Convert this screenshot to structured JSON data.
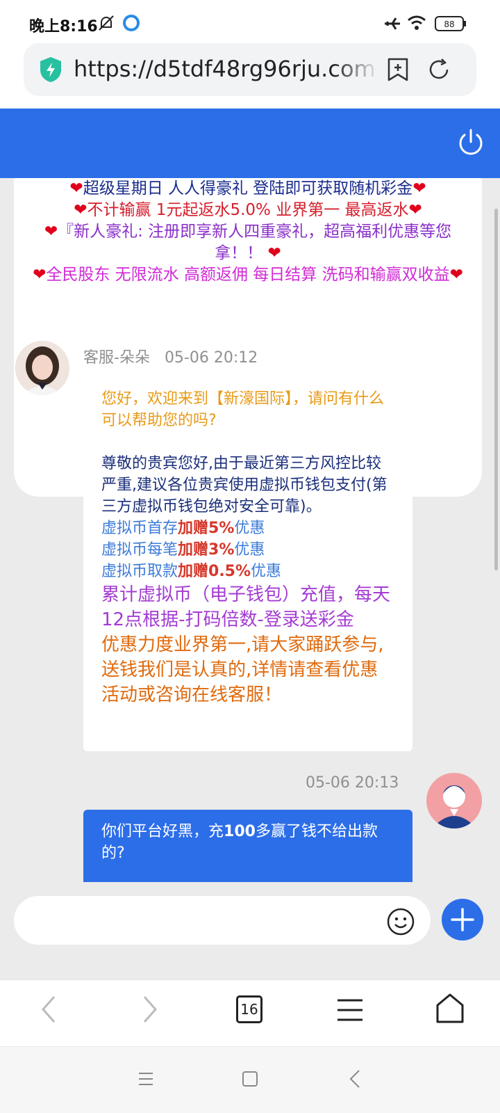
{
  "status_bar": {
    "time": "晚上8:16",
    "battery": "88"
  },
  "browser": {
    "url": "https://d5tdf48rg96rju.com",
    "tab_count": "16"
  },
  "promo": {
    "lines": [
      {
        "text": "超级星期日 人人得豪礼 登陆即可获取随机彩金",
        "color": "#1a2c8c"
      },
      {
        "text": "不计输赢 1元起返水5.0% 业界第一 最高返水",
        "color": "#d61e2c"
      },
      {
        "text": "『新人豪礼: 注册即享新人四重豪礼，超高福利优惠等您拿！！",
        "color": "#8a2fc9"
      },
      {
        "text": "全民股东 无限流水 高额返佣 每日结算 洗码和输赢双收益",
        "color": "#d12ad6"
      }
    ]
  },
  "agent_message": {
    "sender": "客服-朵朵",
    "time": "05-06 20:12",
    "greeting": "您好，欢迎来到【新濠国际】，请问有什么可以帮助您的吗?",
    "notice": "尊敬的贵宾您好,由于最近第三方风控比较严重,建议各位贵宾使用虚拟币钱包支付(第三方虚拟币钱包绝对安全可靠)。",
    "bonus1_prefix": "虚拟币首存",
    "bonus1_value": "加赠5%",
    "bonus1_suffix": "优惠",
    "bonus2_prefix": "虚拟币每笔",
    "bonus2_value": "加赠3%",
    "bonus2_suffix": "优惠",
    "bonus3_prefix": "虚拟币取款",
    "bonus3_value": "加赠0.5%",
    "bonus3_suffix": "优惠",
    "accumulate": "累计虚拟币（电子钱包）充值，每天12点根据-打码倍数-登录送彩金",
    "promotion": "优惠力度业界第一,请大家踊跃参与,送钱我们是认真的,详情请查看优惠活动或咨询在线客服！"
  },
  "my_message": {
    "time": "05-06 20:13",
    "text_a": "你们平台好黑，充",
    "text_b": "100",
    "text_c": "多赢了钱不给出款的?"
  },
  "colors": {
    "accent": "#2c6ee8",
    "background": "#ebebeb"
  },
  "icons": {
    "status": [
      "mute-bell-icon",
      "app-icon",
      "airplane-icon",
      "wifi-icon",
      "battery-icon"
    ],
    "url_bar": [
      "shield-icon",
      "bookmark-add-icon",
      "refresh-icon"
    ],
    "header": [
      "power-icon"
    ],
    "input": [
      "emoji-icon",
      "plus-icon"
    ],
    "browser_nav": [
      "back-icon",
      "forward-icon",
      "tabs-icon",
      "menu-icon",
      "home-icon"
    ],
    "system_nav": [
      "recents-icon",
      "home-square-icon",
      "back-triangle-icon"
    ]
  }
}
